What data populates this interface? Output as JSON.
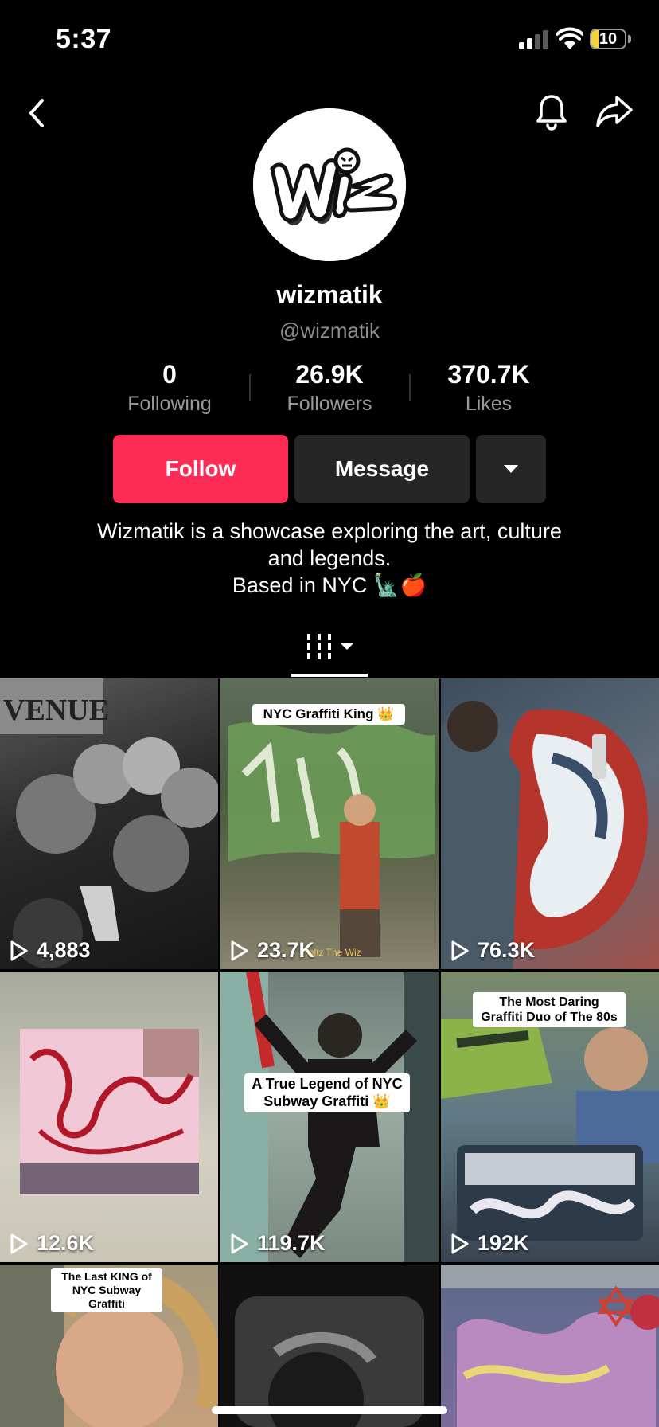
{
  "status_bar": {
    "time": "5:37",
    "battery": "10",
    "battery_color": "#f5d33a"
  },
  "profile": {
    "display_name": "wizmatik",
    "handle": "@wizmatik",
    "stats": [
      {
        "value": "0",
        "label": "Following"
      },
      {
        "value": "26.9K",
        "label": "Followers"
      },
      {
        "value": "370.7K",
        "label": "Likes"
      }
    ],
    "bio_line1": "Wizmatik is a showcase exploring the art, culture",
    "bio_line2": "and legends.",
    "bio_line3": "Based in NYC 🗽🍎"
  },
  "actions": {
    "follow_label": "Follow",
    "message_label": "Message",
    "follow_color": "#fe2c55"
  },
  "videos": [
    {
      "views": "4,883",
      "caption": ""
    },
    {
      "views": "23.7K",
      "caption": "NYC Graffiti King 👑",
      "watermark": "Waltz The Wiz"
    },
    {
      "views": "76.3K",
      "caption": ""
    },
    {
      "views": "12.6K",
      "caption": ""
    },
    {
      "views": "119.7K",
      "caption": "A True Legend of NYC Subway Graffiti 👑"
    },
    {
      "views": "192K",
      "caption": "The Most Daring Graffiti Duo of The 80s"
    },
    {
      "views": "",
      "caption": "The Last KING of NYC Subway Graffiti"
    },
    {
      "views": "",
      "caption": ""
    },
    {
      "views": "",
      "caption": ""
    }
  ],
  "icons": [
    "back-chevron-icon",
    "bell-icon",
    "share-arrow-icon",
    "grid-filter-icon",
    "play-icon",
    "dropdown-caret-icon"
  ]
}
